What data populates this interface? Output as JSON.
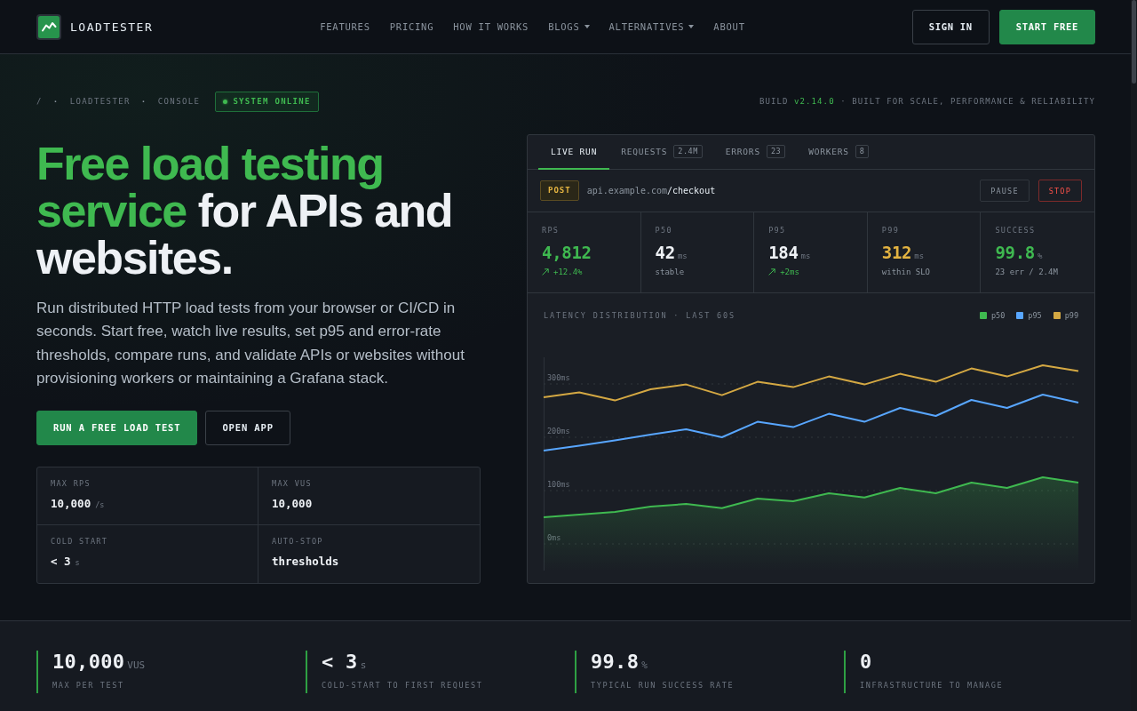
{
  "nav": {
    "brand": "LOADTESTER",
    "links": [
      {
        "label": "FEATURES",
        "dropdown": false
      },
      {
        "label": "PRICING",
        "dropdown": false
      },
      {
        "label": "HOW IT WORKS",
        "dropdown": false
      },
      {
        "label": "BLOGS",
        "dropdown": true
      },
      {
        "label": "ALTERNATIVES",
        "dropdown": true
      },
      {
        "label": "ABOUT",
        "dropdown": false
      }
    ],
    "buttons": [
      {
        "label": "SIGN IN",
        "kind": "outline"
      },
      {
        "label": "START FREE",
        "kind": "primary"
      }
    ]
  },
  "breadcrumb": {
    "trail": [
      {
        "text": "/",
        "kind": "root"
      },
      {
        "text": "·",
        "kind": "separator"
      },
      {
        "text": "LOADTESTER",
        "kind": "item"
      },
      {
        "text": "·",
        "kind": "separator"
      },
      {
        "text": "CONSOLE",
        "kind": "item"
      }
    ],
    "status": "SYSTEM ONLINE"
  },
  "build_info": {
    "label": "BUILD",
    "version": "v2.14.0",
    "tagline": "· BUILT FOR SCALE, PERFORMANCE & RELIABILITY"
  },
  "hero": {
    "headline_highlight": "Free load testing service",
    "headline_rest": "for APIs and websites.",
    "description": "Run distributed HTTP load tests from your browser or CI/CD in seconds. Start free, watch live results, set p95 and error-rate thresholds, compare runs, and validate APIs or websites without provisioning workers or maintaining a Grafana stack.",
    "buttons": [
      {
        "label": "RUN A FREE LOAD TEST",
        "kind": "primary"
      },
      {
        "label": "OPEN APP",
        "kind": "outline"
      }
    ],
    "specs": [
      {
        "label": "MAX RPS",
        "value": "10,000",
        "unit": "/s"
      },
      {
        "label": "MAX VUS",
        "value": "10,000"
      },
      {
        "label": "COLD START",
        "value": "< 3",
        "unit": "s"
      },
      {
        "label": "AUTO-STOP",
        "value": "thresholds"
      }
    ]
  },
  "console": {
    "tabs": [
      {
        "label": "LIVE RUN",
        "selected": true
      },
      {
        "label": "REQUESTS",
        "count": "2.4M",
        "selected": false
      },
      {
        "label": "ERRORS",
        "count": "23",
        "selected": false
      },
      {
        "label": "WORKERS",
        "count": "8",
        "selected": false
      }
    ],
    "request": {
      "method": "POST",
      "host": "api.example.com",
      "path": "/checkout"
    },
    "controls": [
      {
        "label": "PAUSE",
        "kind": "neutral"
      },
      {
        "label": "STOP",
        "kind": "danger"
      }
    ],
    "metrics": [
      {
        "label": "RPS",
        "value": "4,812",
        "color": "#3fb950",
        "rising": true,
        "note": "+12.4%"
      },
      {
        "label": "P50",
        "value": "42",
        "unit": "ms",
        "color": "#eef1f5",
        "rising": false,
        "note": "stable"
      },
      {
        "label": "P95",
        "value": "184",
        "unit": "ms",
        "color": "#eef1f5",
        "rising": true,
        "note": "+2ms"
      },
      {
        "label": "P99",
        "value": "312",
        "unit": "ms",
        "color": "#e3b341",
        "rising": false,
        "note": "within SLO"
      },
      {
        "label": "SUCCESS",
        "value": "99.8",
        "unit": "%",
        "color": "#3fb950",
        "rising": false,
        "note": "23 err / 2.4M"
      }
    ],
    "chart": {
      "chart_data": {
        "type": "line",
        "title": "LATENCY DISTRIBUTION · LAST 60S",
        "grid": true,
        "legend": true,
        "ylim": [
          -50,
          350
        ],
        "yticks": [
          {
            "value": 0,
            "label": "0ms"
          },
          {
            "value": 100,
            "label": "100ms"
          },
          {
            "value": 200,
            "label": "200ms"
          },
          {
            "value": 300,
            "label": "300ms"
          }
        ],
        "series": [
          {
            "name": "p50",
            "color": "#3fb950",
            "values": [
              50,
              55,
              60,
              70,
              75,
              67,
              85,
              80,
              95,
              87,
              105,
              95,
              115,
              105,
              125,
              115
            ]
          },
          {
            "name": "p95",
            "color": "#58a6ff",
            "values": [
              175,
              184,
              194,
              205,
              215,
              200,
              229,
              219,
              244,
              229,
              255,
              240,
              270,
              255,
              280,
              265
            ]
          },
          {
            "name": "p99",
            "color": "#d4a843",
            "values": [
              275,
              284,
              269,
              290,
              299,
              279,
              304,
              294,
              314,
              299,
              319,
              304,
              329,
              314,
              335,
              324
            ]
          }
        ]
      }
    }
  },
  "stats": [
    {
      "value": "10,000",
      "unit": "VUS",
      "label": "MAX PER TEST"
    },
    {
      "value": "< 3",
      "unit": "s",
      "label": "COLD-START TO FIRST REQUEST"
    },
    {
      "value": "99.8",
      "unit": "%",
      "label": "TYPICAL RUN SUCCESS RATE"
    },
    {
      "value": "0",
      "label": "INFRASTRUCTURE TO MANAGE"
    }
  ]
}
